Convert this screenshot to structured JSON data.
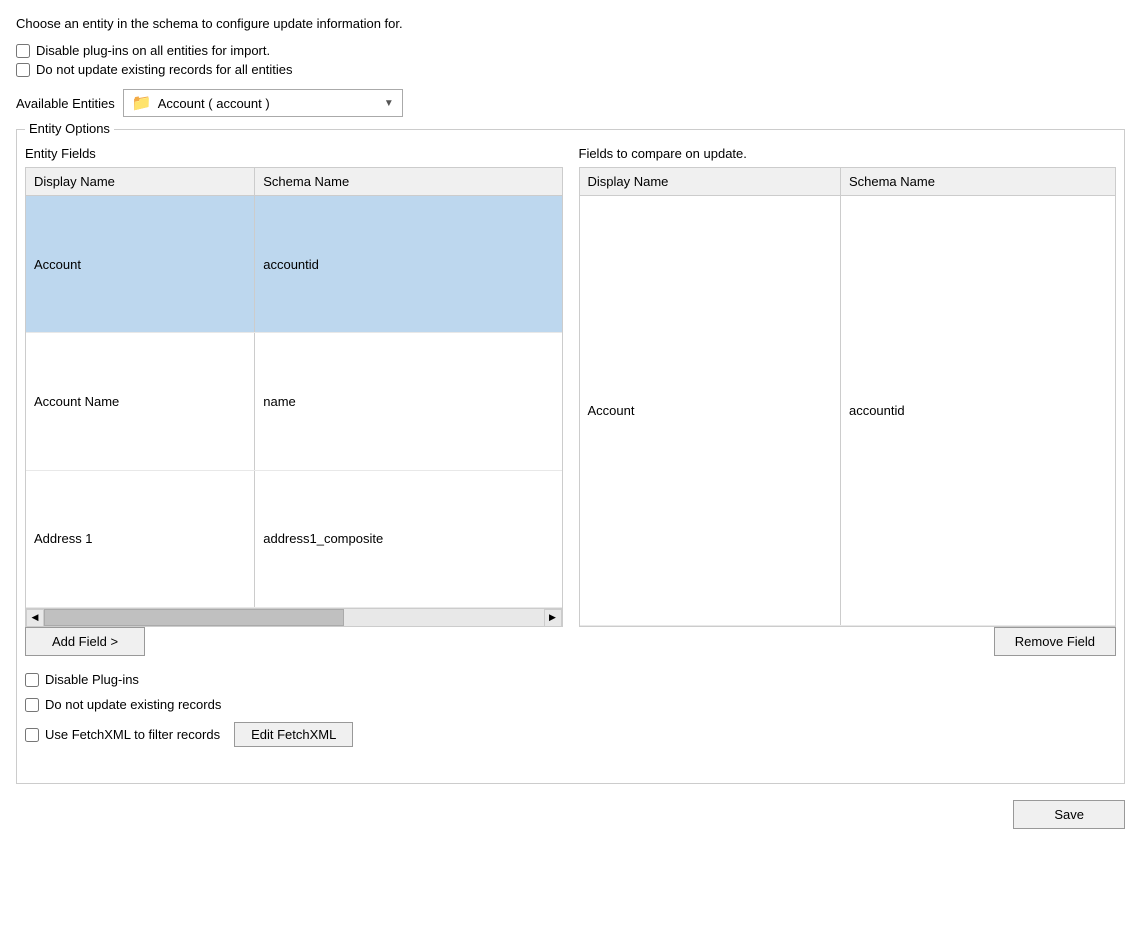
{
  "page": {
    "instructions": "Choose an entity in the schema to configure update information for.",
    "global_checkboxes": [
      {
        "id": "disable-plugins-all",
        "label": "Disable plug-ins on all entities for import.",
        "checked": false
      },
      {
        "id": "no-update-all",
        "label": "Do not update existing records for all entities",
        "checked": false
      }
    ],
    "entity_selector": {
      "label": "Available Entities",
      "icon": "📁",
      "selected": "Account  (  account  )",
      "options": [
        "Account  (  account  )"
      ]
    },
    "entity_options_legend": "Entity Options",
    "entity_fields_title": "Entity Fields",
    "compare_fields_title": "Fields to compare on update.",
    "entity_fields_columns": [
      "Display Name",
      "Schema Name"
    ],
    "entity_fields_rows": [
      {
        "display": "Account",
        "schema": "accountid",
        "selected": true
      },
      {
        "display": "Account Name",
        "schema": "name",
        "selected": false
      },
      {
        "display": "Address 1",
        "schema": "address1_composite",
        "selected": false
      }
    ],
    "compare_fields_columns": [
      "Display Name",
      "Schema Name"
    ],
    "compare_fields_rows": [
      {
        "display": "Account",
        "schema": "accountid"
      }
    ],
    "add_field_btn": "Add Field >",
    "remove_field_btn": "Remove Field",
    "bottom_checkboxes": [
      {
        "id": "disable-plugins",
        "label": "Disable Plug-ins",
        "checked": false
      },
      {
        "id": "no-update-records",
        "label": "Do not update existing records",
        "checked": false
      },
      {
        "id": "use-fetchxml",
        "label": "Use FetchXML to filter records",
        "checked": false
      }
    ],
    "edit_fetchxml_btn": "Edit FetchXML",
    "save_btn": "Save"
  }
}
